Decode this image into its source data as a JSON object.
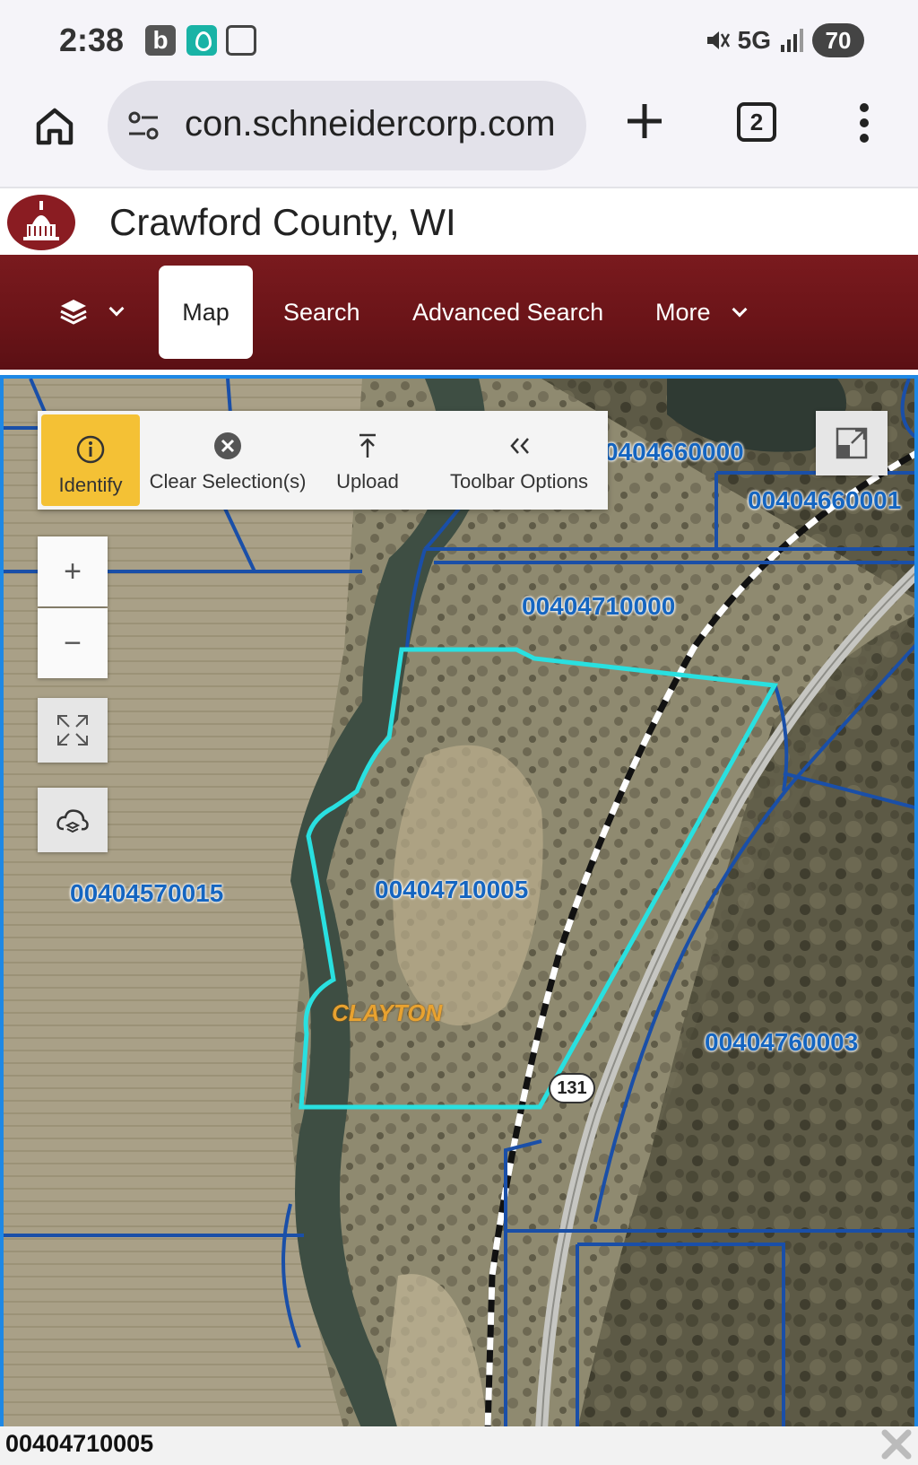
{
  "status_bar": {
    "time": "2:38",
    "b_badge": "b",
    "network": "5G",
    "battery": "70",
    "icons": [
      "b-app-icon",
      "location-app-icon",
      "screenshot-icon",
      "mute-icon",
      "signal-icon",
      "battery-icon"
    ]
  },
  "browser": {
    "url": "con.schneidercorp.com",
    "tab_count": "2",
    "icons": [
      "home-icon",
      "site-settings-icon",
      "new-tab-icon",
      "tabs-icon",
      "menu-icon"
    ]
  },
  "site": {
    "title": "Crawford County, WI",
    "logo": "county-courthouse-logo"
  },
  "nav": {
    "layers_icon": "layers-icon",
    "tabs": [
      {
        "label": "Map",
        "active": true
      },
      {
        "label": "Search",
        "active": false
      },
      {
        "label": "Advanced Search",
        "active": false
      },
      {
        "label": "More",
        "active": false
      }
    ],
    "colors": {
      "nav_bg": "#6a1418",
      "active_bg": "#ffffff"
    }
  },
  "map": {
    "toolbar": [
      {
        "label": "Identify",
        "icon": "info-icon",
        "active": true
      },
      {
        "label": "Clear Selection(s)",
        "icon": "clear-circle-icon",
        "active": false
      },
      {
        "label": "Upload",
        "icon": "upload-icon",
        "active": false
      },
      {
        "label": "Toolbar Options",
        "icon": "double-chevron-left-icon",
        "active": false
      }
    ],
    "controls": {
      "zoom_in": "+",
      "zoom_out": "−",
      "full_extent_icon": "full-extent-icon",
      "basemap_icon": "cloud-layers-icon",
      "fullscreen_icon": "expand-window-icon"
    },
    "parcels": [
      {
        "id": "0404660000"
      },
      {
        "id": "00404660001"
      },
      {
        "id": "00404710000"
      },
      {
        "id": "00404570015"
      },
      {
        "id": "00404710005"
      },
      {
        "id": "00404760003"
      }
    ],
    "place_label": "CLAYTON",
    "highway_shield": "131",
    "colors": {
      "parcel_line": "#1a4fa8",
      "selection": "#29e0e0",
      "label": "#1565c0",
      "toolbar_active": "#f4c135"
    }
  },
  "selection_bar": {
    "selected_parcel": "00404710005",
    "close_icon": "close-x-icon"
  }
}
